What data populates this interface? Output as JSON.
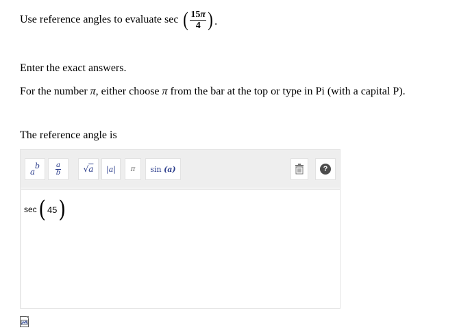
{
  "question": {
    "prefix": "Use reference angles to evaluate sec",
    "numerator": "15",
    "pi_symbol": "π",
    "denominator": "4",
    "suffix": "."
  },
  "instructions": {
    "line1": "Enter the exact answers.",
    "line2_before": "For the number ",
    "line2_pi": "π",
    "line2_mid": ", either choose ",
    "line2_pi2": "π",
    "line2_after": " from the bar at the top or type in Pi (with a capital P)."
  },
  "prompt": "The reference angle is",
  "toolbar": {
    "buttons": [
      {
        "name": "superscript-button",
        "glyph": "a^b"
      },
      {
        "name": "fraction-button",
        "glyph": "a/b"
      },
      {
        "name": "sqrt-button",
        "glyph": "√a"
      },
      {
        "name": "abs-button",
        "glyph": "|a|"
      },
      {
        "name": "pi-button",
        "glyph": "π"
      },
      {
        "name": "sin-button",
        "glyph": "sin (a)"
      }
    ],
    "sin_label": "sin",
    "sin_arg": "(a)",
    "pi_label": "π",
    "abs_label": "|a|",
    "sqrt_arg": "a",
    "frac_num": "a",
    "frac_den": "b",
    "pow_base": "a",
    "pow_exp": "b",
    "help_label": "?"
  },
  "answer": {
    "function": "sec",
    "value": "45"
  },
  "colors": {
    "toolbar_bg": "#eeeeee",
    "glyph_blue": "#2b3d8c",
    "help_bg": "#4d4d4d"
  }
}
